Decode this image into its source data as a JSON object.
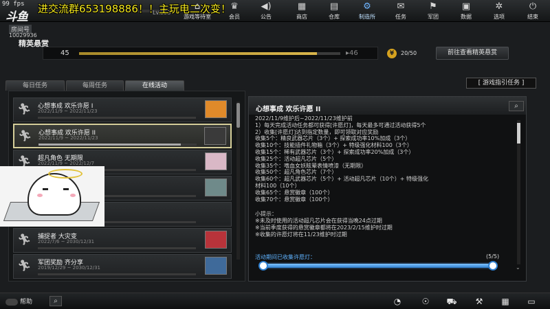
{
  "top": {
    "fps": "99 fps",
    "logo": "斗鱼",
    "overlay": "进交流群653198886！！主玩电二次变！",
    "level": "Lv.253",
    "nav": [
      {
        "label": "游戏等待室",
        "icon": "lobby-icon"
      },
      {
        "label": "会员",
        "icon": "member-icon"
      },
      {
        "label": "公告",
        "icon": "announcement-icon"
      },
      {
        "label": "商店",
        "icon": "shop-icon"
      },
      {
        "label": "仓库",
        "icon": "warehouse-icon"
      },
      {
        "label": "制造所",
        "icon": "factory-icon"
      },
      {
        "label": "任务",
        "icon": "mission-icon"
      },
      {
        "label": "军团",
        "icon": "clan-icon"
      },
      {
        "label": "数据",
        "icon": "data-icon"
      },
      {
        "label": "选项",
        "icon": "options-icon"
      },
      {
        "label": "结束",
        "icon": "power-icon"
      }
    ]
  },
  "header": {
    "room_label": "房间号",
    "room_id": "10029936",
    "title": "精英悬赏",
    "progress_from": "45",
    "progress_to": "46",
    "progress_fraction": 0.91,
    "coin_count": "20/50",
    "goto_button": "前往查看精英悬赏"
  },
  "tabs": [
    "每日任务",
    "每周任务",
    "在线活动"
  ],
  "guide_button": "[ 游戏指引任务 ]",
  "events": [
    {
      "name": "心想事成 欢乐许愿 I",
      "date": "2022/11/9 ~ 2022/11/23",
      "thumb": "#e08a2a",
      "progress": 0.0
    },
    {
      "name": "心想事成 欢乐许愿 II",
      "date": "2022/11/9 ~ 2022/11/23",
      "thumb": "#3a3a3a",
      "progress": 0.9
    },
    {
      "name": "超凡角色 无期限",
      "date": "2022/11/9 ~ 2022/12/7",
      "thumb": "#d9b8c6",
      "progress": 0.0
    },
    {
      "name": "",
      "date": "",
      "thumb": "#6f8a8a",
      "progress": 0.0
    },
    {
      "name": "",
      "date": "",
      "thumb": "",
      "progress": 0.0
    },
    {
      "name": "捕捉者 大灾变",
      "date": "2022/7/6 ~ 2030/12/31",
      "thumb": "#b8333a",
      "progress": 0.0
    },
    {
      "name": "军团奖励 齐分享",
      "date": "2019/12/29 ~ 2030/12/31",
      "thumb": "#3f6a9a",
      "progress": 0.0
    }
  ],
  "detail": {
    "title": "心想事成 欢乐许愿 II",
    "rules": [
      "2022/11/9维护后~2022/11/23维护前",
      "1）每天完成活动任务都可获得[许愿灯]，每天最多可通过活动获得5个",
      "2）收集[许愿灯]达到指定数量，即可领取对应奖励",
      "    收集5个：精良武器芯片（3个）+ 探索成功率10%加成（3个）",
      "    收集10个：技能插件礼物箱（3个）+ 特级强化材料100（3个）",
      "    收集15个：稀有武器芯片（3个）+ 探索成功率20%加成（3个）",
      "    收集25个：活动超凡芯片（5个）",
      "    收集35个：嗜血女妖眩晕表情喷漆（无期限）",
      "    收集50个：超凡角色芯片（7个）",
      "    收集60个：超凡武器芯片（5个）+ 活动超凡芯片（10个）+ 特级强化",
      "              材料100（10个）",
      "    收集65个：悬赏徽章（100个）",
      "    收集70个：悬赏徽章（100个）"
    ],
    "tips": [
      "小提示：",
      "※未及时使用的活动超凡芯片会在获得当晚24点过期",
      "※当前季度获得的悬赏徽章都将在2023/2/15维护时过期",
      "※收集的许愿灯将在11/23维护时过期"
    ],
    "collect_label": "活动期间已收集许愿灯：",
    "collect_count": "(5/5)",
    "collect_fraction": 1.0
  },
  "bottom": {
    "help": "帮助",
    "icons": [
      "compass-icon",
      "runner-icon",
      "cart-icon",
      "hammer-icon",
      "calendar-icon",
      "battery-icon"
    ]
  }
}
